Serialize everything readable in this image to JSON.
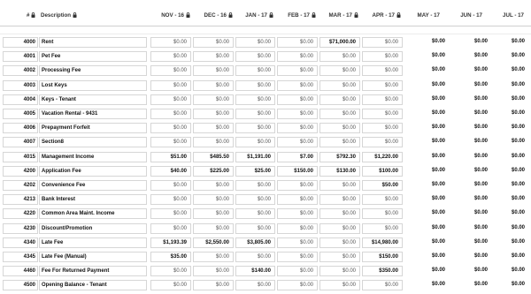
{
  "header": {
    "num_label": "#",
    "desc_label": "Description",
    "months": [
      "NOV - 16",
      "DEC - 16",
      "JAN - 17",
      "FEB - 17",
      "MAR - 17",
      "APR - 17",
      "MAY - 17",
      "JUN - 17",
      "JUL - 17"
    ],
    "locked_months": [
      true,
      true,
      true,
      true,
      true,
      true,
      false,
      false,
      false
    ]
  },
  "rows": [
    {
      "num": "4000",
      "desc": "Rent",
      "vals": [
        "$0.00",
        "$0.00",
        "$0.00",
        "$0.00",
        "$71,000.00",
        "$0.00",
        "$0.00",
        "$0.00",
        "$0.00"
      ]
    },
    {
      "num": "4001",
      "desc": "Pet Fee",
      "vals": [
        "$0.00",
        "$0.00",
        "$0.00",
        "$0.00",
        "$0.00",
        "$0.00",
        "$0.00",
        "$0.00",
        "$0.00"
      ]
    },
    {
      "num": "4002",
      "desc": "Processing Fee",
      "vals": [
        "$0.00",
        "$0.00",
        "$0.00",
        "$0.00",
        "$0.00",
        "$0.00",
        "$0.00",
        "$0.00",
        "$0.00"
      ]
    },
    {
      "num": "4003",
      "desc": "Lost Keys",
      "vals": [
        "$0.00",
        "$0.00",
        "$0.00",
        "$0.00",
        "$0.00",
        "$0.00",
        "$0.00",
        "$0.00",
        "$0.00"
      ]
    },
    {
      "num": "4004",
      "desc": "Keys - Tenant",
      "vals": [
        "$0.00",
        "$0.00",
        "$0.00",
        "$0.00",
        "$0.00",
        "$0.00",
        "$0.00",
        "$0.00",
        "$0.00"
      ]
    },
    {
      "num": "4005",
      "desc": "Vacation Rental - 9431",
      "vals": [
        "$0.00",
        "$0.00",
        "$0.00",
        "$0.00",
        "$0.00",
        "$0.00",
        "$0.00",
        "$0.00",
        "$0.00"
      ]
    },
    {
      "num": "4006",
      "desc": "Prepayment Forfeit",
      "vals": [
        "$0.00",
        "$0.00",
        "$0.00",
        "$0.00",
        "$0.00",
        "$0.00",
        "$0.00",
        "$0.00",
        "$0.00"
      ]
    },
    {
      "num": "4007",
      "desc": "Section8",
      "vals": [
        "$0.00",
        "$0.00",
        "$0.00",
        "$0.00",
        "$0.00",
        "$0.00",
        "$0.00",
        "$0.00",
        "$0.00"
      ]
    },
    {
      "num": "4015",
      "desc": "Management Income",
      "vals": [
        "$51.00",
        "$485.50",
        "$1,191.00",
        "$7.00",
        "$792.30",
        "$1,220.00",
        "$0.00",
        "$0.00",
        "$0.00"
      ]
    },
    {
      "num": "4200",
      "desc": "Application Fee",
      "vals": [
        "$40.00",
        "$225.00",
        "$25.00",
        "$150.00",
        "$130.00",
        "$100.00",
        "$0.00",
        "$0.00",
        "$0.00"
      ]
    },
    {
      "num": "4202",
      "desc": "Convenience Fee",
      "vals": [
        "$0.00",
        "$0.00",
        "$0.00",
        "$0.00",
        "$0.00",
        "$50.00",
        "$0.00",
        "$0.00",
        "$0.00"
      ]
    },
    {
      "num": "4213",
      "desc": "Bank Interest",
      "vals": [
        "$0.00",
        "$0.00",
        "$0.00",
        "$0.00",
        "$0.00",
        "$0.00",
        "$0.00",
        "$0.00",
        "$0.00"
      ]
    },
    {
      "num": "4220",
      "desc": "Common Area Maint. Income",
      "vals": [
        "$0.00",
        "$0.00",
        "$0.00",
        "$0.00",
        "$0.00",
        "$0.00",
        "$0.00",
        "$0.00",
        "$0.00"
      ]
    },
    {
      "num": "4230",
      "desc": "Discount/Promotion",
      "vals": [
        "$0.00",
        "$0.00",
        "$0.00",
        "$0.00",
        "$0.00",
        "$0.00",
        "$0.00",
        "$0.00",
        "$0.00"
      ]
    },
    {
      "num": "4340",
      "desc": "Late Fee",
      "vals": [
        "$1,193.39",
        "$2,550.00",
        "$3,805.00",
        "$0.00",
        "$0.00",
        "$14,980.00",
        "$0.00",
        "$0.00",
        "$0.00"
      ]
    },
    {
      "num": "4345",
      "desc": "Late Fee (Manual)",
      "vals": [
        "$35.00",
        "$0.00",
        "$0.00",
        "$0.00",
        "$0.00",
        "$150.00",
        "$0.00",
        "$0.00",
        "$0.00"
      ]
    },
    {
      "num": "4460",
      "desc": "Fee For Returned Payment",
      "vals": [
        "$0.00",
        "$0.00",
        "$140.00",
        "$0.00",
        "$0.00",
        "$350.00",
        "$0.00",
        "$0.00",
        "$0.00"
      ]
    },
    {
      "num": "4500",
      "desc": "Opening Balance - Tenant",
      "vals": [
        "$0.00",
        "$0.00",
        "$0.00",
        "$0.00",
        "$0.00",
        "$0.00",
        "$0.00",
        "$0.00",
        "$0.00"
      ]
    }
  ],
  "colors": {
    "border": "#d6d6d6",
    "header_border": "#cfcfcf",
    "text_dark": "#111111",
    "text_muted": "#555555"
  },
  "icons": {
    "lock": "lock-icon"
  }
}
